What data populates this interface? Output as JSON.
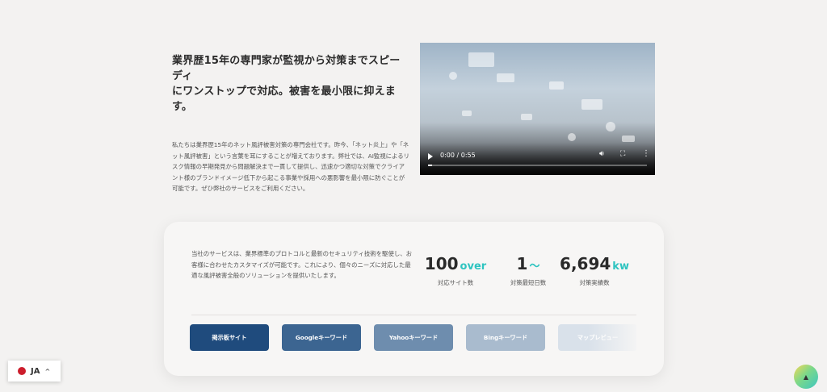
{
  "intro": {
    "headline_line1": "業界歴15年の専門家が監視から対策までスピーディ",
    "headline_line2": "にワンストップで対応。被害を最小限に抑えます。",
    "body": "私たちは業界歴15年のネット風評被害対策の専門会社です。昨今、「ネット炎上」や「ネット風評被害」という言葉を耳にすることが増えております。弊社では、AI監視によるリスク情報の早期発見から問題解決まで一貫して提供し、迅速かつ適切な対策でクライアント様のブランドイメージ低下から起こる事業や採用への悪影響を最小限に防ぐことが可能です。ぜひ弊社のサービスをご利用ください。"
  },
  "video": {
    "time": "0:00 / 0:55",
    "progress": 0.02
  },
  "services": {
    "description": "当社のサービスは、業界標準のプロトコルと最新のセキュリティ技術を駆使し、お客様に合わせたカスタマイズが可能です。これにより、個々のニーズに対応した最適な風評被害全般のソリューションを提供いたします。",
    "stats": [
      {
        "value": "100",
        "unit": "over",
        "label": "対応サイト数"
      },
      {
        "value": "1",
        "unit": "〜",
        "label": "対策最短日数"
      },
      {
        "value": "6,694",
        "unit": "kw",
        "label": "対策実績数"
      }
    ],
    "tabs": [
      {
        "label": "掲示板サイト",
        "color": "#1f4b7d"
      },
      {
        "label": "Googleキーワード",
        "color": "#3c6591"
      },
      {
        "label": "Yahooキーワード",
        "color": "#6e8dae"
      },
      {
        "label": "Bingキーワード",
        "color": "#a9bbce"
      },
      {
        "label": "マップレビュー",
        "color": "#d9e1ea"
      }
    ]
  },
  "language": {
    "code": "JA"
  },
  "colors": {
    "accent": "#2ec4c0",
    "background": "#f3f2f1"
  }
}
